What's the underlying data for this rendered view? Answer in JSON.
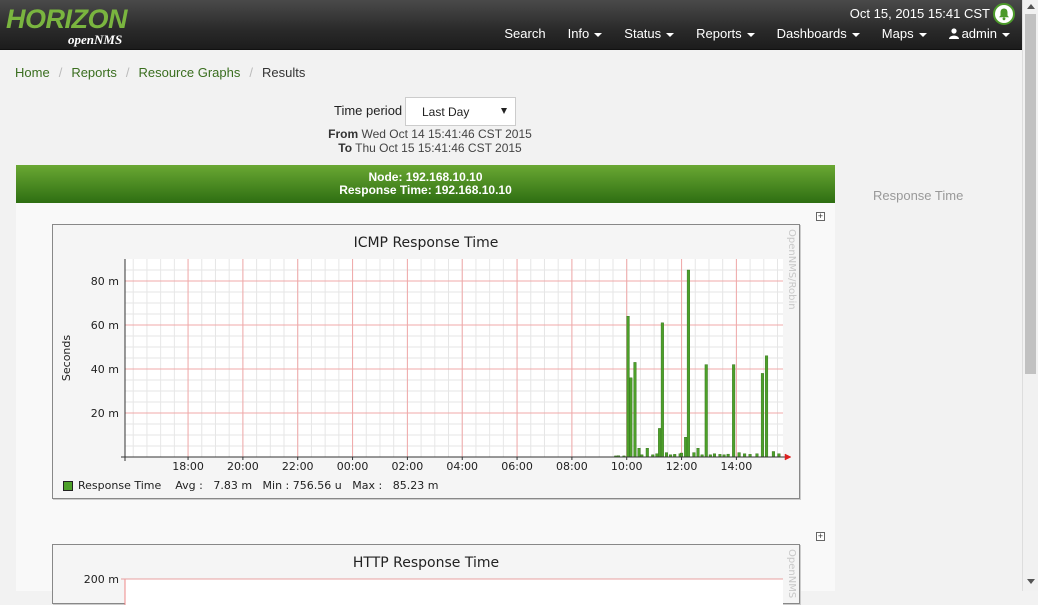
{
  "nav": {
    "logo_top": "HORIZON",
    "logo_bottom": "openNMS",
    "datetime": "Oct 15, 2015 15:41 CST",
    "items": [
      {
        "label": "Search",
        "dropdown": false
      },
      {
        "label": "Info",
        "dropdown": true
      },
      {
        "label": "Status",
        "dropdown": true
      },
      {
        "label": "Reports",
        "dropdown": true
      },
      {
        "label": "Dashboards",
        "dropdown": true
      },
      {
        "label": "Maps",
        "dropdown": true
      }
    ],
    "user": "admin"
  },
  "breadcrumb": [
    "Home",
    "Reports",
    "Resource Graphs",
    "Results"
  ],
  "time_period": {
    "label": "Time period",
    "selected": "Last Day",
    "from_label": "From",
    "from_value": "Wed Oct 14 15:41:46 CST 2015",
    "to_label": "To",
    "to_value": "Thu Oct 15 15:41:46 CST 2015"
  },
  "panel": {
    "node_line": "Node: 192.168.10.10",
    "resource_line": "Response Time: 192.168.10.10",
    "side_label": "Response Time",
    "expand_symbol": "+"
  },
  "graphs": [
    {
      "title": "ICMP Response Time",
      "watermark": "OpenNMS/Robin",
      "ylabel": "Seconds",
      "legend_name": "Response Time",
      "avg_label": "Avg :",
      "avg_value": "7.83 m",
      "min_label": "Min :",
      "min_value": "756.56 u",
      "max_label": "Max :",
      "max_value": "85.23 m"
    },
    {
      "title": "HTTP Response Time",
      "watermark": "OpenNMS",
      "top_tick": "200 m"
    }
  ],
  "chart_data": {
    "type": "bar",
    "title": "ICMP Response Time",
    "ylabel": "Seconds",
    "xlabel": "",
    "x_ticks": [
      "18:00",
      "20:00",
      "22:00",
      "00:00",
      "02:00",
      "04:00",
      "06:00",
      "08:00",
      "10:00",
      "12:00",
      "14:00"
    ],
    "x_tick_hours": [
      18,
      20,
      22,
      24,
      26,
      28,
      30,
      32,
      34,
      36,
      38
    ],
    "y_ticks": [
      "20 m",
      "40 m",
      "60 m",
      "80 m"
    ],
    "y_tick_values": [
      20,
      40,
      60,
      80
    ],
    "ylim": [
      0,
      90
    ],
    "xlim": [
      15.7,
      39.7
    ],
    "grid": true,
    "series": [
      {
        "name": "Response Time",
        "color": "#4da02a",
        "points": [
          [
            33.6,
            0.5
          ],
          [
            33.7,
            0.6
          ],
          [
            33.9,
            0.5
          ],
          [
            34.05,
            64
          ],
          [
            34.15,
            36
          ],
          [
            34.3,
            43
          ],
          [
            34.45,
            4
          ],
          [
            34.55,
            1
          ],
          [
            34.75,
            4
          ],
          [
            34.95,
            1
          ],
          [
            35.1,
            1.5
          ],
          [
            35.2,
            13
          ],
          [
            35.3,
            61
          ],
          [
            35.45,
            2
          ],
          [
            35.6,
            1
          ],
          [
            35.75,
            1.2
          ],
          [
            35.95,
            1.5
          ],
          [
            36.0,
            1.8
          ],
          [
            36.15,
            9
          ],
          [
            36.25,
            85
          ],
          [
            36.45,
            2
          ],
          [
            36.6,
            4
          ],
          [
            36.75,
            1
          ],
          [
            36.9,
            42
          ],
          [
            37.05,
            1
          ],
          [
            37.2,
            1.5
          ],
          [
            37.4,
            1.2
          ],
          [
            37.55,
            1
          ],
          [
            37.7,
            1.3
          ],
          [
            37.9,
            42
          ],
          [
            38.1,
            2
          ],
          [
            38.3,
            1.5
          ],
          [
            38.5,
            1.2
          ],
          [
            38.75,
            1.5
          ],
          [
            38.95,
            38
          ],
          [
            39.1,
            46
          ],
          [
            39.35,
            2.5
          ],
          [
            39.55,
            1.5
          ]
        ]
      }
    ],
    "stats": {
      "avg": "7.83 m",
      "min": "756.56 u",
      "max": "85.23 m"
    }
  }
}
